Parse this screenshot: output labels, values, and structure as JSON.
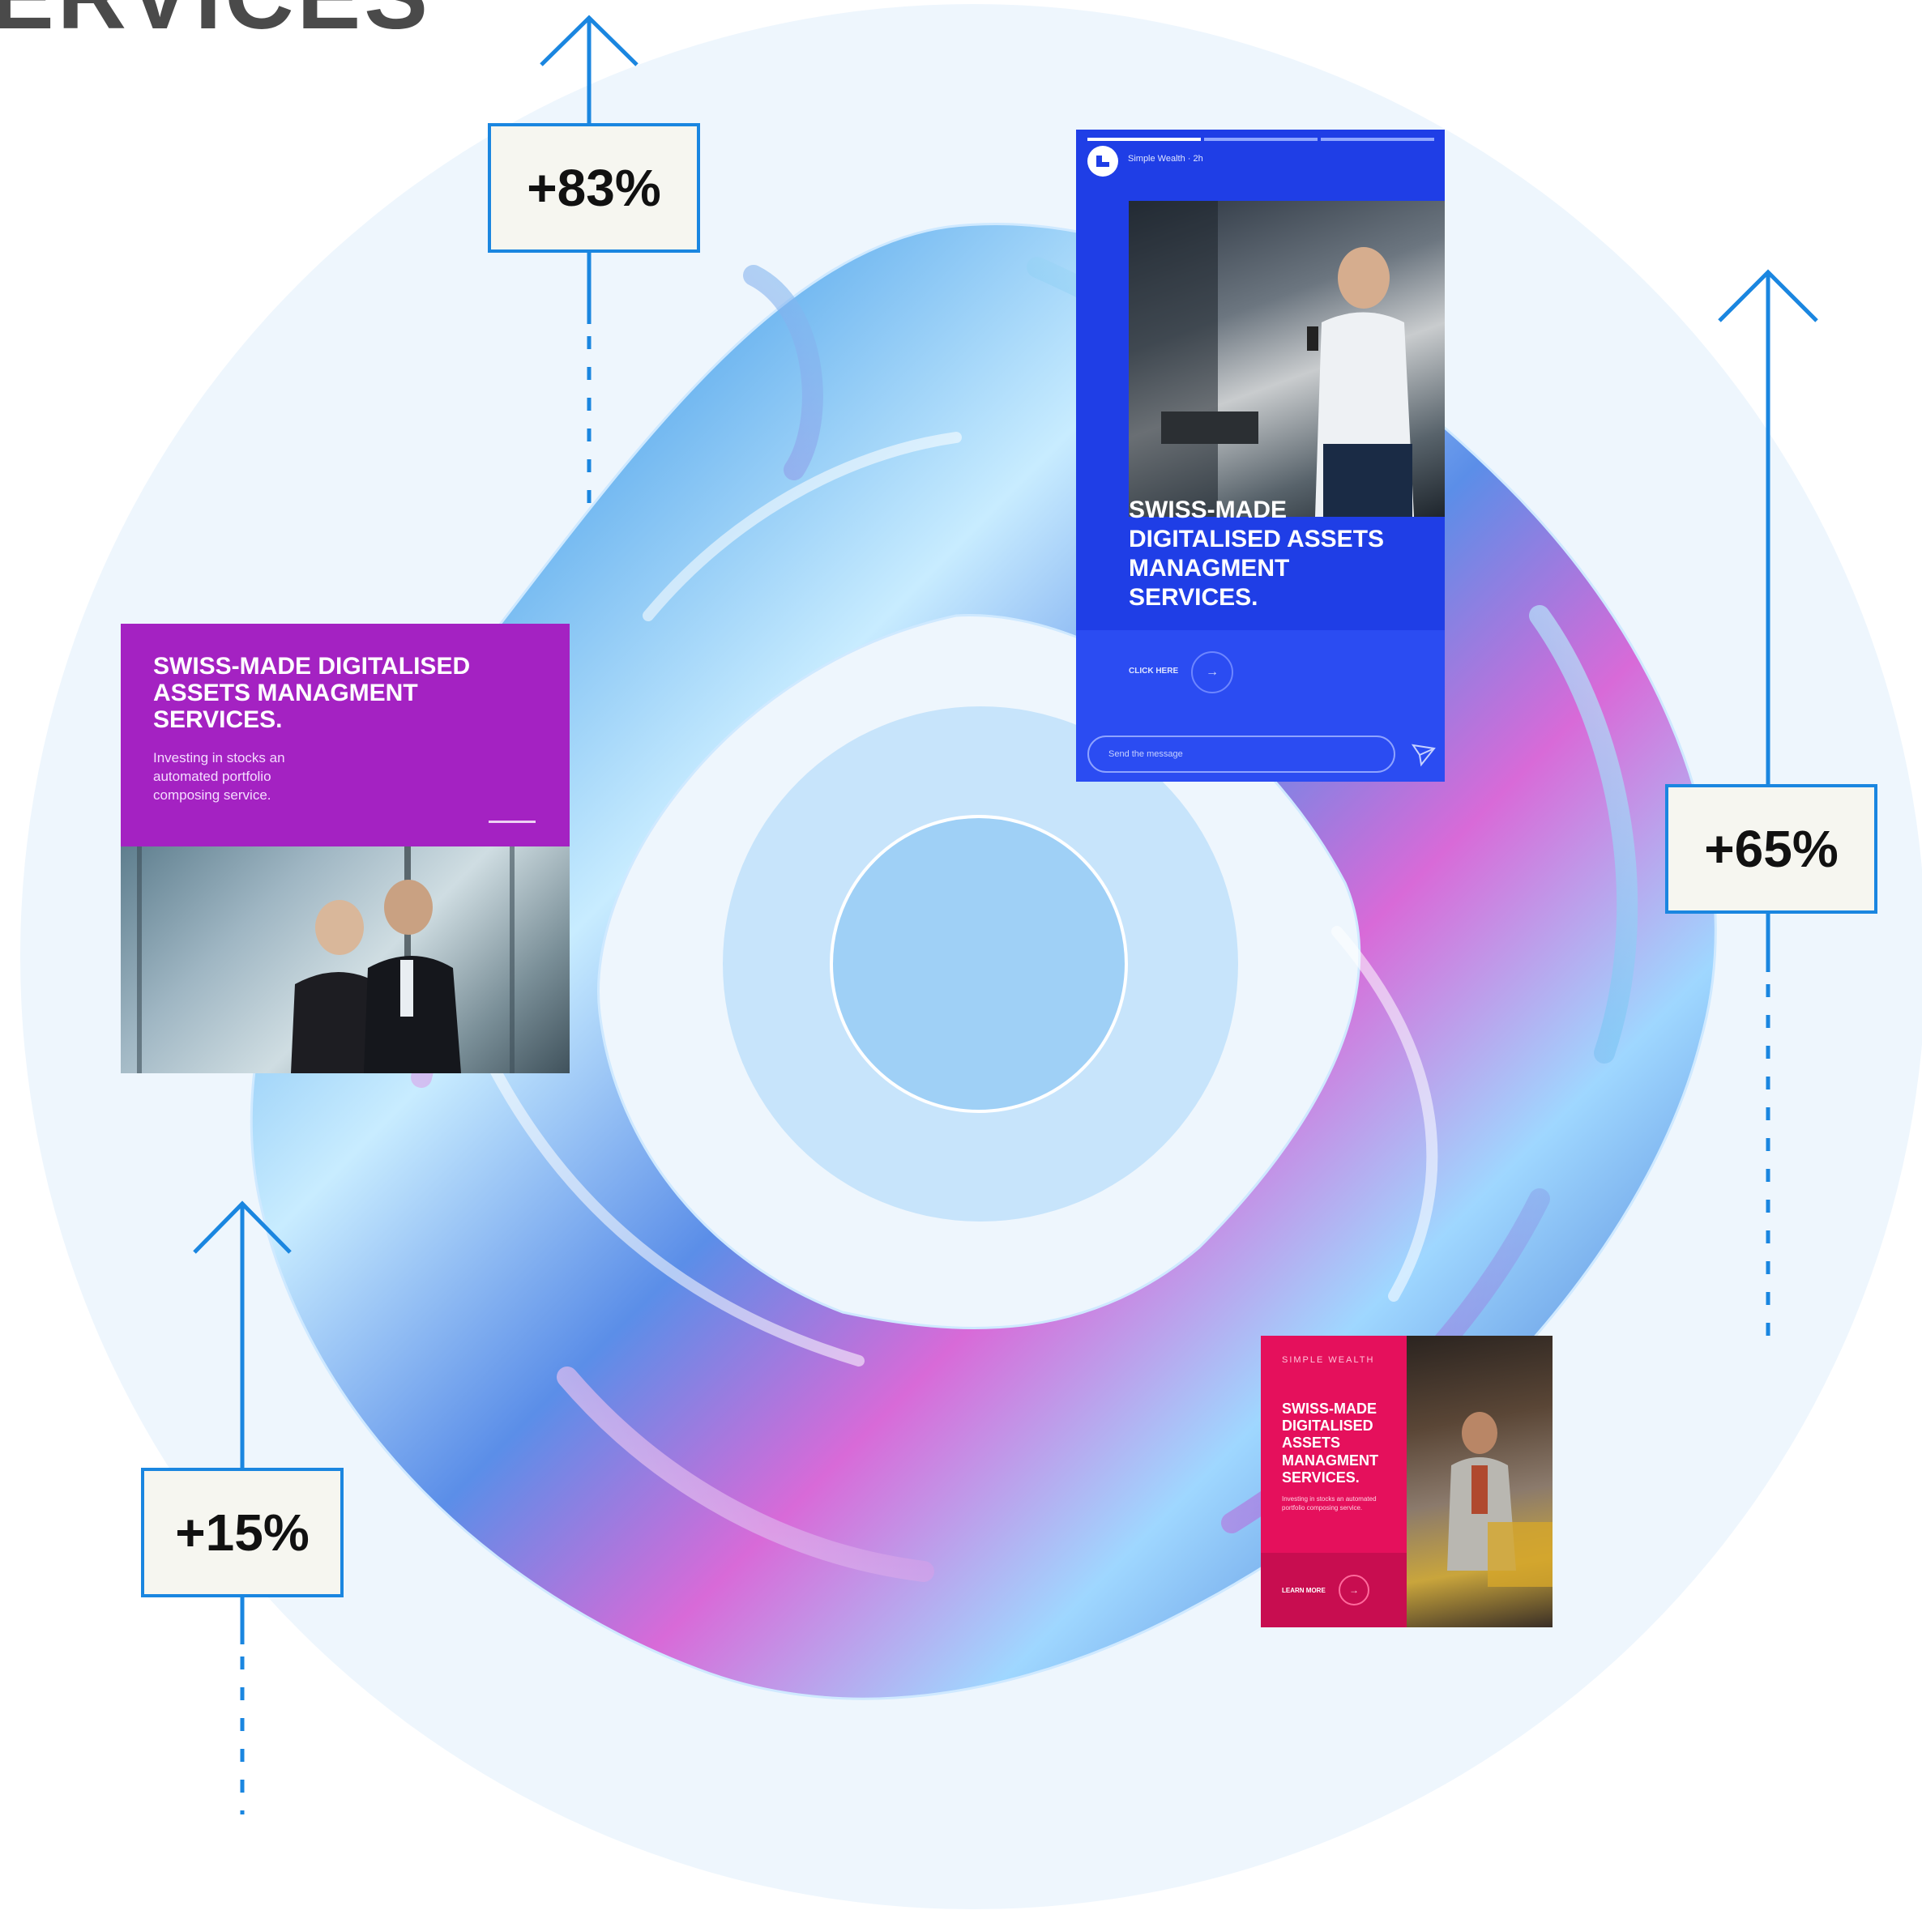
{
  "heading": {
    "text": "ERVICES"
  },
  "stats": {
    "top": "+83%",
    "right": "+65%",
    "left": "+15%"
  },
  "card_purple": {
    "title": "SWISS-MADE DIGITALISED ASSETS MANAGMENT SERVICES.",
    "body": "Investing in stocks an automated portfolio composing service."
  },
  "card_blue": {
    "brand": "Simple Wealth · 2h",
    "title": "SWISS-MADE DIGITALISED ASSETS MANAGMENT SERVICES.",
    "cta": "CLICK HERE",
    "message_placeholder": "Send the message"
  },
  "card_pink": {
    "brand": "SIMPLE WEALTH",
    "title": "SWISS-MADE DIGITALISED ASSETS MANAGMENT SERVICES.",
    "body": "Investing in stocks an automated portfolio composing service.",
    "cta": "LEARN MORE"
  },
  "colors": {
    "accent": "#1a86e0",
    "purple": "#a422c2",
    "blue": "#1f3ee6",
    "pink": "#e5105c",
    "circle_light": "#eef6fd"
  },
  "icons": [
    "arrow-up-icon",
    "send-icon",
    "arrow-right-icon",
    "logo-icon"
  ]
}
